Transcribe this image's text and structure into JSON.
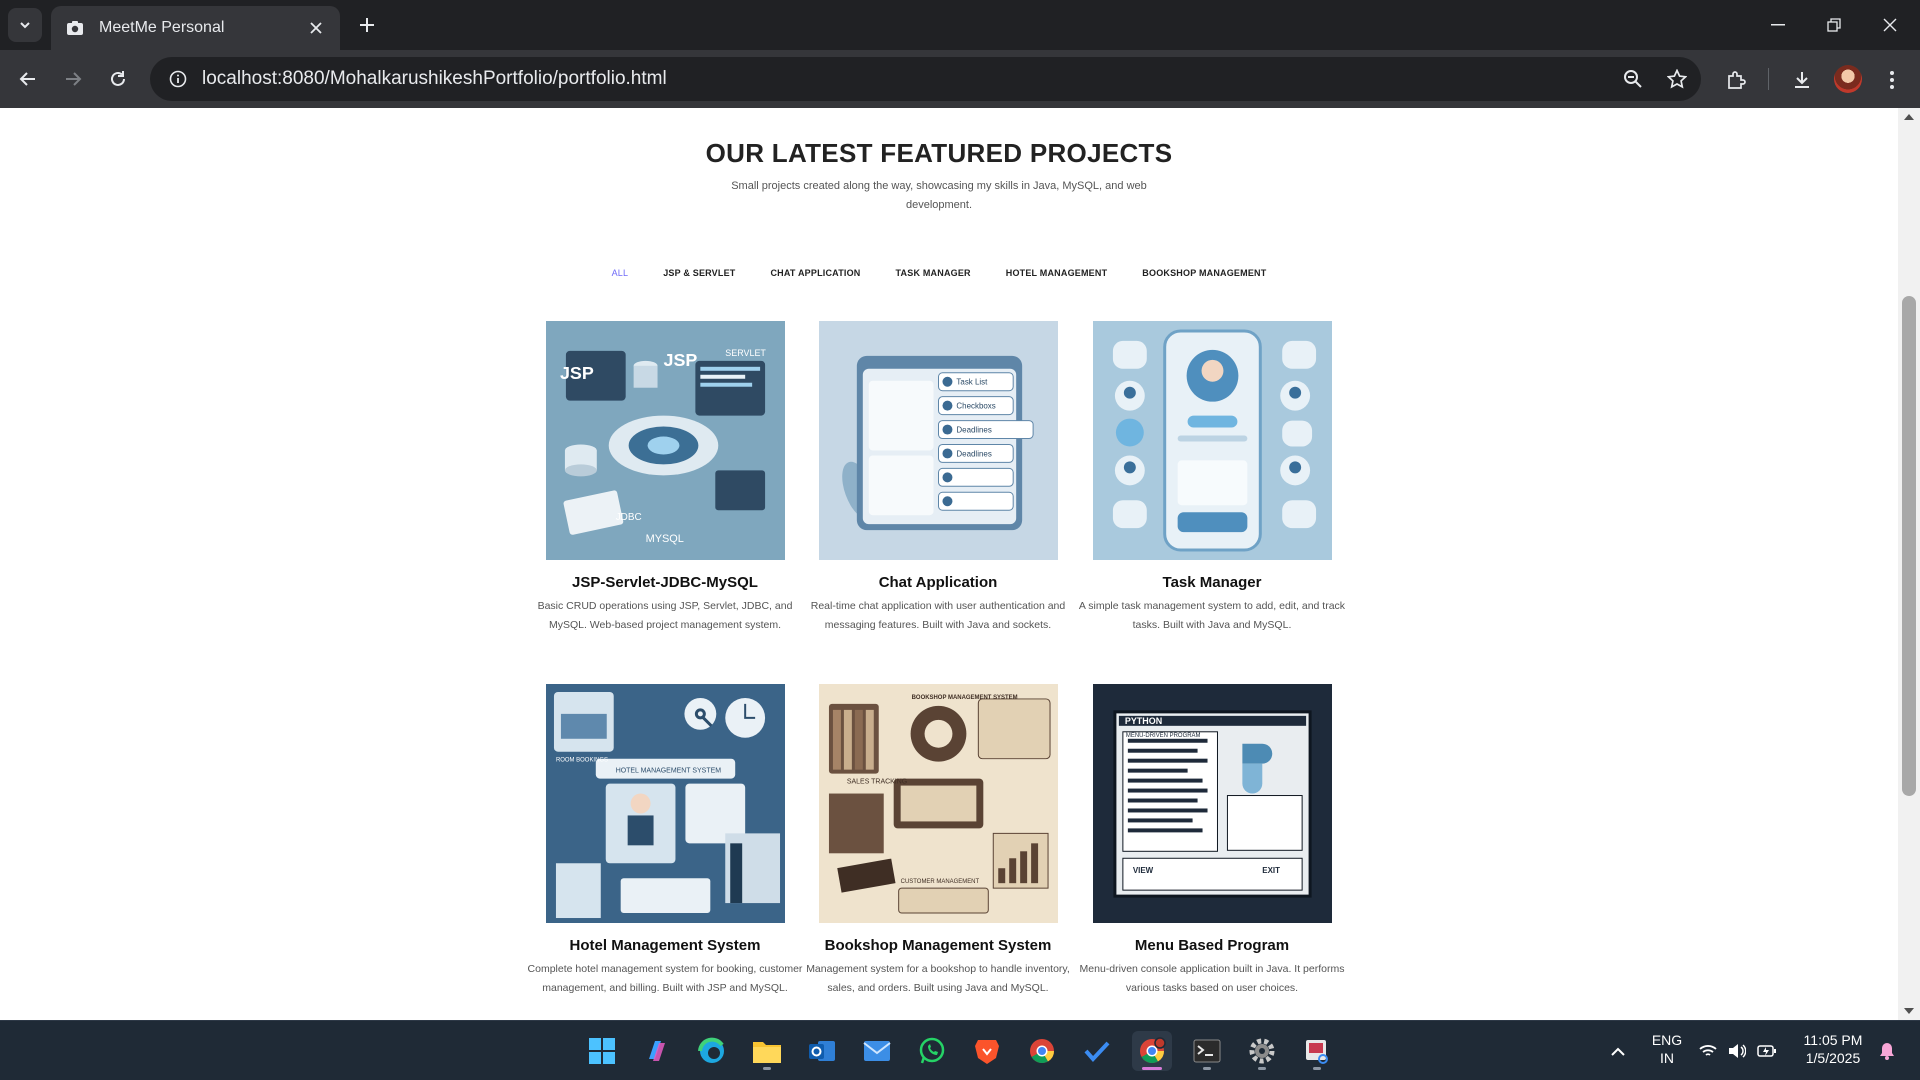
{
  "browser": {
    "tab_title": "MeetMe Personal",
    "url": "localhost:8080/MohalkarushikeshPortfolio/portfolio.html"
  },
  "page": {
    "title": "OUR LATEST FEATURED PROJECTS",
    "subtitle": "Small projects created along the way, showcasing my skills in Java, MySQL, and web development.",
    "filters": [
      {
        "label": "ALL",
        "active": true
      },
      {
        "label": "JSP & SERVLET",
        "active": false
      },
      {
        "label": "CHAT APPLICATION",
        "active": false
      },
      {
        "label": "TASK MANAGER",
        "active": false
      },
      {
        "label": "HOTEL MANAGEMENT",
        "active": false
      },
      {
        "label": "BOOKSHOP MANAGEMENT",
        "active": false
      }
    ],
    "projects": [
      {
        "title": "JSP-Servlet-JDBC-MySQL",
        "description": "Basic CRUD operations using JSP, Servlet, JDBC, and MySQL. Web-based project management system.",
        "thumb_label_1": "JSP",
        "thumb_label_2": "JDBC",
        "thumb_label_3": "MYSQL",
        "thumb_label_4": "SERVLET"
      },
      {
        "title": "Chat Application",
        "description": "Real-time chat application with user authentication and messaging features. Built with Java and sockets.",
        "thumb_label_1": "Task List",
        "thumb_label_2": "Checkboxs",
        "thumb_label_3": "Deadlines",
        "thumb_label_4": "Deadlines"
      },
      {
        "title": "Task Manager",
        "description": "A simple task management system to add, edit, and track tasks. Built with Java and MySQL."
      },
      {
        "title": "Hotel Management System",
        "description": "Complete hotel management system for booking, customer management, and billing. Built with JSP and MySQL.",
        "thumb_label_1": "HOTEL MANAGEMENT SYSTEM",
        "thumb_label_2": "ROOM BOOKINGS"
      },
      {
        "title": "Bookshop Management System",
        "description": "Management system for a bookshop to handle inventory, sales, and orders. Built using Java and MySQL.",
        "thumb_label_1": "BOOKSHOP MANAGEMENT SYSTEM",
        "thumb_label_2": "SALES TRACKING",
        "thumb_label_3": "CUSTOMER MANAGEMENT"
      },
      {
        "title": "Menu Based Program",
        "description": "Menu-driven console application built in Java. It performs various tasks based on user choices.",
        "thumb_label_1": "PYTHON",
        "thumb_label_2": "MENU-DRIVEN PROGRAM",
        "thumb_label_3": "VIEW",
        "thumb_label_4": "EXIT"
      }
    ]
  },
  "taskbar": {
    "lang_line1": "ENG",
    "lang_line2": "IN",
    "time": "11:05 PM",
    "date": "1/5/2025"
  },
  "colors": {
    "accent": "#6f6af8",
    "chrome_dark": "#202124",
    "chrome_mid": "#35363a",
    "taskbar": "#1f2a36"
  }
}
